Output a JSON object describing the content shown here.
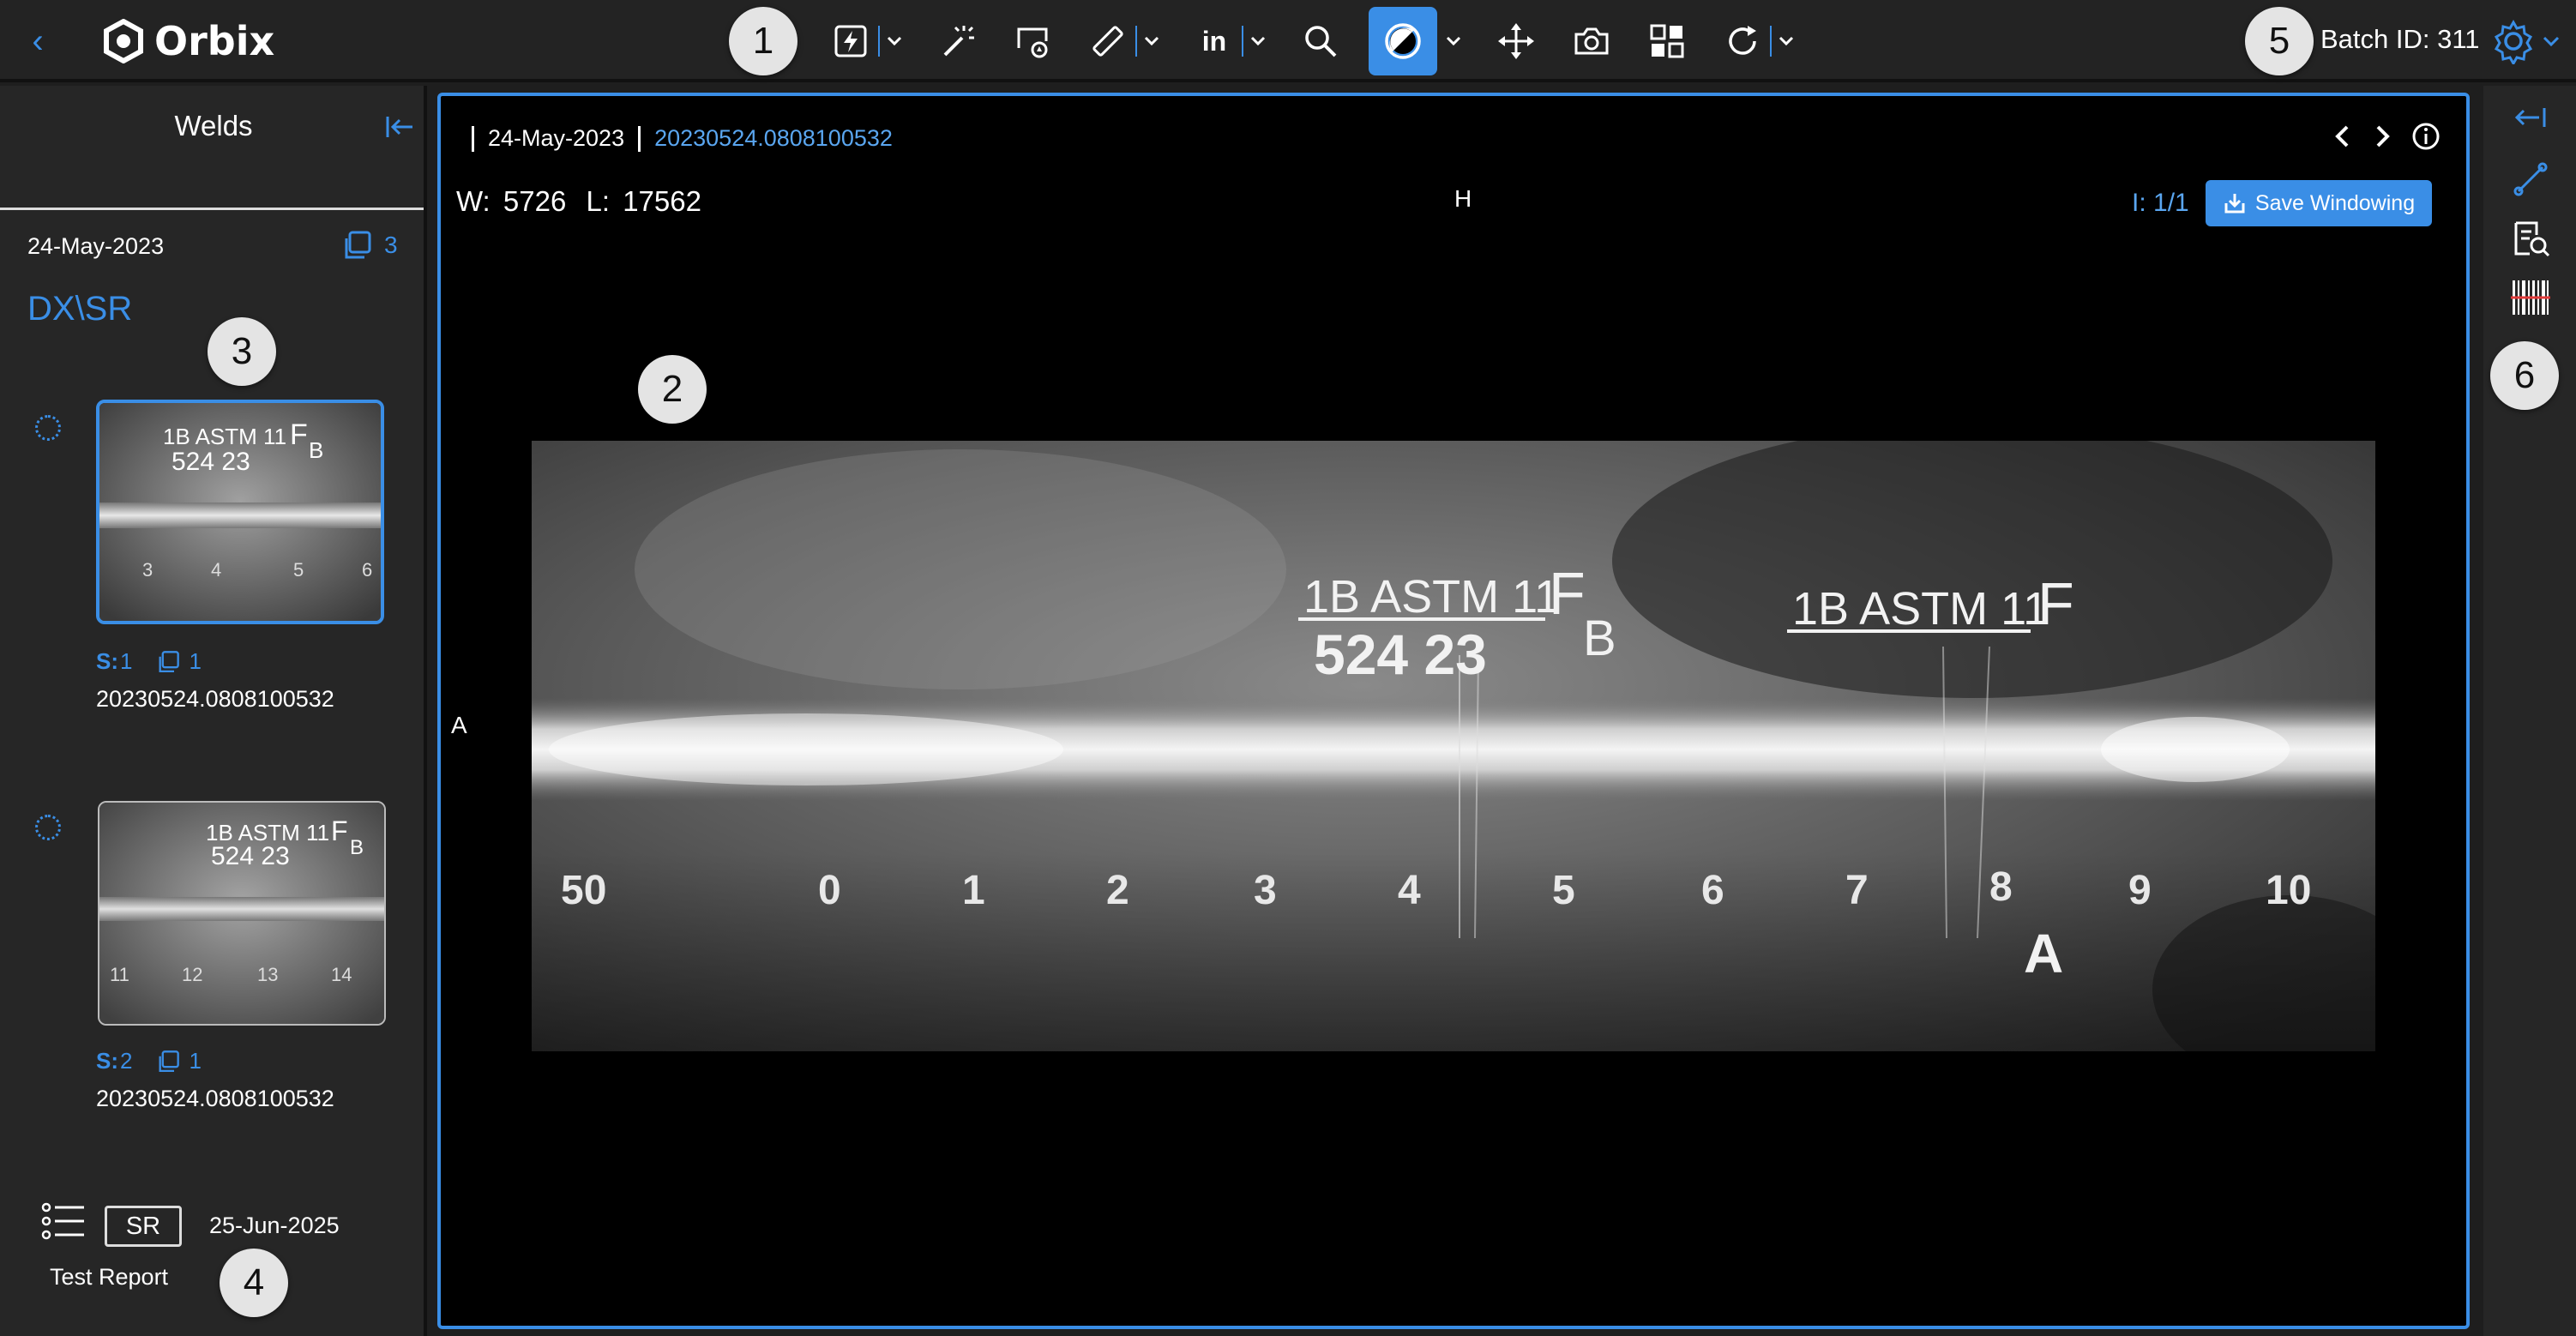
{
  "app": {
    "name": "Orbix"
  },
  "header": {
    "batch_label": "Batch ID: 311"
  },
  "toolbar": {
    "tools": [
      "lightning-tool",
      "magic-wand-tool",
      "roi-tool",
      "ruler-tool",
      "units-tool",
      "zoom-tool",
      "windowing-tool",
      "pan-tool",
      "snapshot-tool",
      "layout-tool",
      "rotate-tool"
    ],
    "units_label": "in"
  },
  "sidebar": {
    "title": "Welds",
    "date": "24-May-2023",
    "copy_count": "3",
    "modality": "DX\\SR",
    "items": [
      {
        "series_prefix": "S:",
        "series_num": "1",
        "copies": "1",
        "id": "20230524.0808100532",
        "selected": true
      },
      {
        "series_prefix": "S:",
        "series_num": "2",
        "copies": "1",
        "id": "20230524.0808100532",
        "selected": false
      }
    ],
    "report": {
      "badge": "SR",
      "date": "25-Jun-2025",
      "label": "Test Report"
    }
  },
  "viewer": {
    "date": "24-May-2023",
    "study_id": "20230524.0808100532",
    "window_label": "W:",
    "window_value": "5726",
    "level_label": "L:",
    "level_value": "17562",
    "marker_top": "H",
    "marker_left": "A",
    "image_counter": "I: 1/1",
    "save_windowing": "Save Windowing",
    "film": {
      "iqi_text_1": "1B ASTM 11",
      "iqi_f_1": "F",
      "iqi_b": "B",
      "date_code": "524 23",
      "iqi_text_2": "1B ASTM 11",
      "iqi_f_2": "F",
      "scale": [
        "50",
        "0",
        "1",
        "2",
        "3",
        "4",
        "5",
        "6",
        "7",
        "8",
        "9",
        "10"
      ],
      "weld_marker": "A"
    },
    "thumb1": {
      "iqi": "1B ASTM 11",
      "f": "F",
      "b": "B",
      "date": "524 23",
      "scale": [
        "3",
        "4",
        "5",
        "6"
      ]
    },
    "thumb2": {
      "iqi": "1B ASTM 11",
      "f": "F",
      "b": "B",
      "date": "524 23",
      "scale": [
        "11",
        "12",
        "13",
        "14"
      ]
    }
  },
  "callouts": [
    "1",
    "2",
    "3",
    "4",
    "5",
    "6"
  ],
  "colors": {
    "accent": "#3a8ee6",
    "background": "#1e1e1e",
    "viewer_bg": "#000000"
  }
}
